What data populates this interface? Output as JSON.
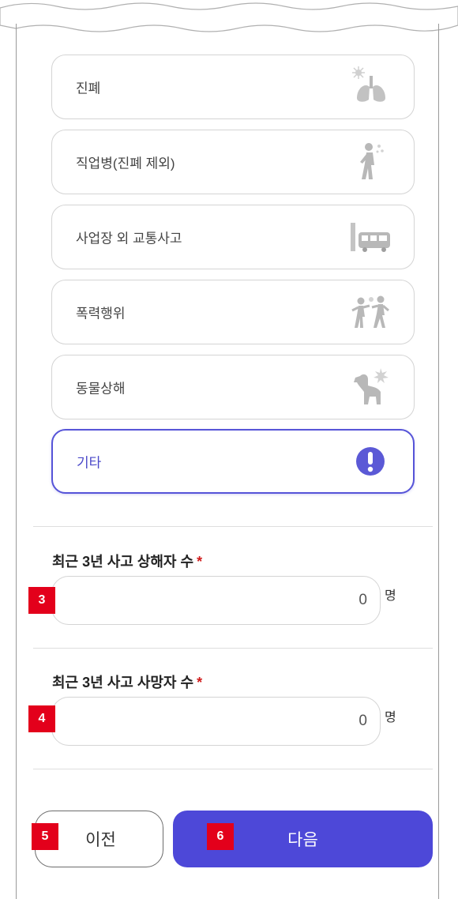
{
  "options": [
    {
      "label": "진폐",
      "icon": "lungs-icon"
    },
    {
      "label": "직업병(진폐 제외)",
      "icon": "walking-worker-icon"
    },
    {
      "label": "사업장 외 교통사고",
      "icon": "bus-icon"
    },
    {
      "label": "폭력행위",
      "icon": "fighting-people-icon"
    },
    {
      "label": "동물상해",
      "icon": "dog-bite-icon"
    },
    {
      "label": "기타",
      "icon": "exclamation-icon",
      "selected": true
    }
  ],
  "injured": {
    "label": "최근 3년 사고 상해자 수",
    "required_mark": "*",
    "value": "0",
    "unit": "명",
    "tag": "3"
  },
  "deaths": {
    "label": "최근 3년 사고 사망자 수",
    "required_mark": "*",
    "value": "0",
    "unit": "명",
    "tag": "4"
  },
  "buttons": {
    "prev_label": "이전",
    "prev_tag": "5",
    "next_label": "다음",
    "next_tag": "6"
  },
  "colors": {
    "accent": "#4d48d8",
    "selected_border": "#5654d8",
    "required": "#d01c1c",
    "tag": "#e3001b",
    "icon_gray": "#b8b8b8"
  }
}
